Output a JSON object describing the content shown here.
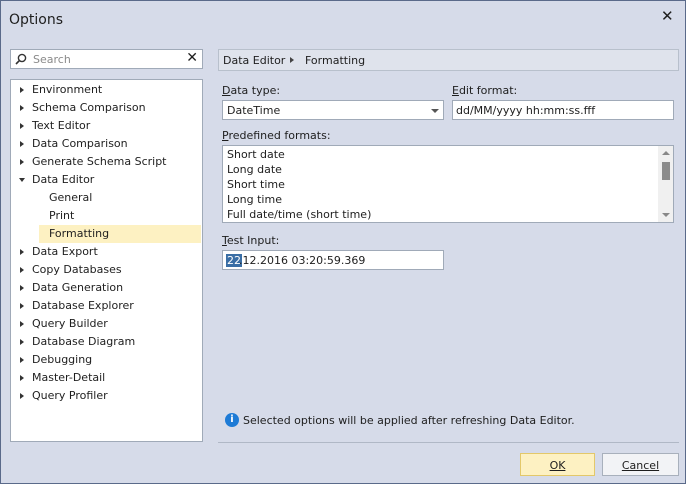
{
  "window": {
    "title": "Options"
  },
  "search": {
    "placeholder": "Search"
  },
  "tree": [
    {
      "label": "Environment",
      "expandable": true
    },
    {
      "label": "Schema Comparison",
      "expandable": true
    },
    {
      "label": "Text Editor",
      "expandable": true
    },
    {
      "label": "Data Comparison",
      "expandable": true
    },
    {
      "label": "Generate Schema Script",
      "expandable": true
    },
    {
      "label": "Data Editor",
      "expandable": true,
      "expanded": true
    },
    {
      "label": "General",
      "child": true
    },
    {
      "label": "Print",
      "child": true
    },
    {
      "label": "Formatting",
      "child": true,
      "selected": true
    },
    {
      "label": "Data Export",
      "expandable": true
    },
    {
      "label": "Copy Databases",
      "expandable": true
    },
    {
      "label": "Data Generation",
      "expandable": true
    },
    {
      "label": "Database Explorer",
      "expandable": true
    },
    {
      "label": "Query Builder",
      "expandable": true
    },
    {
      "label": "Database Diagram",
      "expandable": true
    },
    {
      "label": "Debugging",
      "expandable": true
    },
    {
      "label": "Master-Detail",
      "expandable": true
    },
    {
      "label": "Query Profiler",
      "expandable": true
    }
  ],
  "breadcrumb": {
    "first": "Data Editor",
    "second": "Formatting"
  },
  "data_type": {
    "label_first": "D",
    "label_rest": "ata type:",
    "value": "DateTime"
  },
  "edit_format": {
    "label_first": "E",
    "label_rest": "dit format:",
    "value": "dd/MM/yyyy hh:mm:ss.fff"
  },
  "predefined": {
    "label_first": "P",
    "label_rest": "redefined formats:",
    "items": [
      "Short date",
      "Long date",
      "Short time",
      "Long time",
      "Full date/time (short time)"
    ]
  },
  "test_input": {
    "label_first": "T",
    "label_rest": "est Input:",
    "highlight": "22",
    "rest": ".12.2016 03:20:59.369"
  },
  "info": {
    "text": "Selected options will be applied after refreshing Data Editor."
  },
  "buttons": {
    "ok": "OK",
    "cancel": "Cancel"
  },
  "colors": {
    "window_bg": "#d6dbe9",
    "selected": "#fdf1c2",
    "info": "#1e7bd6"
  }
}
